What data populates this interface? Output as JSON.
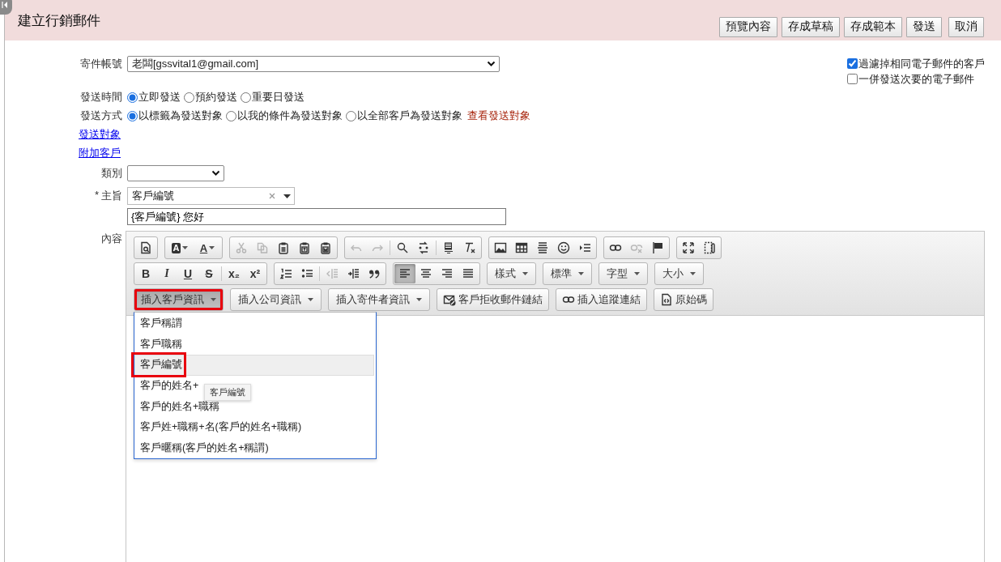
{
  "header": {
    "title": "建立行銷郵件",
    "buttons": [
      "預覽內容",
      "存成草稿",
      "存成範本",
      "發送",
      "取消"
    ]
  },
  "options": [
    {
      "label": "過濾掉相同電子郵件的客戶",
      "checked": true
    },
    {
      "label": "一併發送次要的電子郵件",
      "checked": false
    }
  ],
  "form": {
    "sender": {
      "label": "寄件帳號",
      "value": "老闆[gssvital1@gmail.com]"
    },
    "send_time": {
      "label": "發送時間",
      "options": [
        {
          "label": "立即發送",
          "selected": true
        },
        {
          "label": "預約發送",
          "selected": false
        },
        {
          "label": "重要日發送",
          "selected": false
        }
      ]
    },
    "send_method": {
      "label": "發送方式",
      "options": [
        {
          "label": "以標籤為發送對象",
          "selected": true
        },
        {
          "label": "以我的條件為發送對象",
          "selected": false
        },
        {
          "label": "以全部客戶為發送對象",
          "selected": false
        }
      ],
      "link": "查看發送對象"
    },
    "links": [
      "發送對象",
      "附加客戶"
    ],
    "category": {
      "label": "類別"
    },
    "subject": {
      "required_mark": "*",
      "label": "主旨",
      "tag": "客戶編號",
      "value": "{客戶編號} 您好"
    },
    "content_label": "內容"
  },
  "editor": {
    "toolbar_rows": [
      [
        [
          [
            {
              "kind": "icon",
              "disabled": false,
              "pressed": false
            }
          ]
        ],
        [
          [
            {
              "kind": "color_bg",
              "label": "A",
              "disabled": false,
              "pressed": false
            },
            {
              "kind": "color_text",
              "label": "A",
              "disabled": false,
              "pressed": false
            }
          ]
        ],
        [
          [
            {
              "kind": "icon",
              "disabled": true,
              "pressed": false
            },
            {
              "kind": "icon",
              "disabled": true,
              "pressed": false
            },
            {
              "kind": "icon",
              "disabled": false,
              "pressed": false
            },
            {
              "kind": "icon",
              "disabled": false,
              "pressed": false
            },
            {
              "kind": "icon",
              "disabled": false,
              "pressed": false
            }
          ]
        ],
        [
          [
            {
              "kind": "icon",
              "disabled": true,
              "pressed": false
            },
            {
              "kind": "icon",
              "disabled": true,
              "pressed": false
            }
          ],
          [
            {
              "kind": "icon",
              "disabled": false,
              "pressed": false
            },
            {
              "kind": "icon",
              "disabled": false,
              "pressed": false
            }
          ],
          [
            {
              "kind": "icon",
              "disabled": false,
              "pressed": false
            },
            {
              "kind": "icon",
              "disabled": false,
              "pressed": false
            }
          ]
        ],
        [
          [
            {
              "kind": "icon",
              "disabled": false,
              "pressed": false
            },
            {
              "kind": "icon",
              "disabled": false,
              "pressed": false
            },
            {
              "kind": "icon",
              "disabled": false,
              "pressed": false
            },
            {
              "kind": "icon",
              "disabled": false,
              "pressed": false
            },
            {
              "kind": "icon",
              "disabled": false,
              "pressed": false
            }
          ]
        ],
        [
          [
            {
              "kind": "icon",
              "disabled": false,
              "pressed": false
            },
            {
              "kind": "icon",
              "disabled": true,
              "pressed": false
            },
            {
              "kind": "icon",
              "disabled": false,
              "pressed": false
            }
          ]
        ],
        [
          [
            {
              "kind": "icon",
              "disabled": false,
              "pressed": false
            },
            {
              "kind": "icon",
              "disabled": false,
              "pressed": false
            }
          ]
        ]
      ],
      [
        [
          [
            {
              "kind": "bold",
              "label": "B",
              "disabled": false,
              "pressed": false
            },
            {
              "kind": "italic",
              "label": "I",
              "disabled": false,
              "pressed": false
            },
            {
              "kind": "underline",
              "label": "U",
              "disabled": false,
              "pressed": false
            },
            {
              "kind": "strike",
              "label": "S",
              "disabled": false,
              "pressed": false
            }
          ],
          [
            {
              "kind": "glyph",
              "label": "x₂",
              "disabled": false,
              "pressed": false
            },
            {
              "kind": "glyph",
              "label": "x²",
              "disabled": false,
              "pressed": false
            }
          ]
        ],
        [
          [
            {
              "kind": "icon",
              "disabled": false,
              "pressed": false
            },
            {
              "kind": "icon",
              "disabled": false,
              "pressed": false
            }
          ],
          [
            {
              "kind": "icon",
              "disabled": true,
              "pressed": false
            },
            {
              "kind": "icon",
              "disabled": false,
              "pressed": false
            },
            {
              "kind": "icon",
              "disabled": false,
              "pressed": false
            }
          ]
        ],
        [
          [
            {
              "kind": "icon",
              "disabled": false,
              "pressed": true
            },
            {
              "kind": "icon",
              "disabled": false,
              "pressed": false
            },
            {
              "kind": "icon",
              "disabled": false,
              "pressed": false
            },
            {
              "kind": "icon",
              "disabled": false,
              "pressed": false
            }
          ]
        ],
        [
          [
            {
              "kind": "dropdown",
              "label": "樣式",
              "disabled": false,
              "pressed": false,
              "highlighted": false
            }
          ]
        ],
        [
          [
            {
              "kind": "dropdown",
              "label": "標準",
              "disabled": false,
              "pressed": false,
              "highlighted": false
            }
          ]
        ],
        [
          [
            {
              "kind": "dropdown",
              "label": "字型",
              "disabled": false,
              "pressed": false,
              "highlighted": false
            }
          ]
        ],
        [
          [
            {
              "kind": "dropdown",
              "label": "大小",
              "disabled": false,
              "pressed": false,
              "highlighted": false
            }
          ]
        ]
      ],
      [
        [
          [
            {
              "kind": "dropdown",
              "label": "插入客戶資訊",
              "disabled": false,
              "pressed": true,
              "highlighted": true
            }
          ]
        ],
        [
          [
            {
              "kind": "dropdown",
              "label": "插入公司資訊",
              "disabled": false,
              "pressed": false,
              "highlighted": false
            }
          ]
        ],
        [
          [
            {
              "kind": "dropdown",
              "label": "插入寄件者資訊",
              "disabled": false,
              "pressed": false,
              "highlighted": false
            }
          ]
        ],
        [
          [
            {
              "kind": "icon_label",
              "label": "客戶拒收郵件鏈結",
              "disabled": false,
              "pressed": false
            }
          ]
        ],
        [
          [
            {
              "kind": "icon_label",
              "label": "插入追蹤連結",
              "disabled": false,
              "pressed": false
            }
          ]
        ],
        [
          [
            {
              "kind": "icon_label",
              "label": "原始碼",
              "disabled": false,
              "pressed": false
            }
          ]
        ]
      ]
    ],
    "menu": {
      "items": [
        {
          "label": "客戶稱謂",
          "hovered": false,
          "highlighted": false
        },
        {
          "label": "客戶職稱",
          "hovered": false,
          "highlighted": false
        },
        {
          "label": "客戶編號",
          "hovered": true,
          "highlighted": true
        },
        {
          "label": "客戶的姓名+",
          "hovered": false,
          "highlighted": false
        },
        {
          "label": "客戶的姓名+職稱",
          "hovered": false,
          "highlighted": false
        },
        {
          "label": "客戶姓+職稱+名(客戶的姓名+職稱)",
          "hovered": false,
          "highlighted": false
        },
        {
          "label": "客戶暱稱(客戶的姓名+稱謂)",
          "hovered": false,
          "highlighted": false
        }
      ],
      "tooltip": "客戶編號"
    }
  }
}
